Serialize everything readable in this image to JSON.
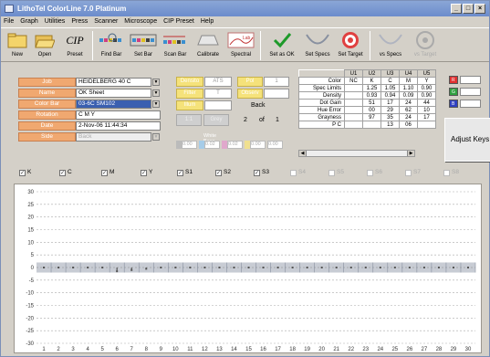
{
  "window": {
    "title": "LithoTel ColorLine 7.0 Platinum",
    "min_glyph": "_",
    "max_glyph": "□",
    "close_glyph": "×"
  },
  "menu": [
    "File",
    "Graph",
    "Utilities",
    "Press",
    "Scanner",
    "Microscope",
    "CIP Preset",
    "Help"
  ],
  "toolbar": [
    {
      "label": "New",
      "icon": "folder-icon"
    },
    {
      "label": "Open",
      "icon": "open-folder-icon"
    },
    {
      "label": "Preset",
      "icon": "cip-icon",
      "icon_text": "CIP"
    },
    {
      "label": "Find Bar",
      "icon": "find-bar-icon"
    },
    {
      "label": "Set Bar",
      "icon": "set-bar-icon"
    },
    {
      "label": "Scan Bar",
      "icon": "scan-bar-icon"
    },
    {
      "label": "Calibrate",
      "icon": "calibrate-icon"
    },
    {
      "label": "Spectral",
      "icon": "spectral-icon",
      "icon_text": "Lab"
    },
    {
      "label": "Set as OK",
      "icon": "checkmark-icon"
    },
    {
      "label": "Set Specs",
      "icon": "specs-icon"
    },
    {
      "label": "Set Target",
      "icon": "target-icon"
    },
    {
      "label": "vs Specs",
      "icon": "vs-specs-icon"
    },
    {
      "label": "vs Target",
      "icon": "vs-target-icon"
    }
  ],
  "job_panel": {
    "fields": [
      {
        "label": "Job",
        "value": "HEIDELBERG 40 C",
        "dropdown": true
      },
      {
        "label": "Name",
        "value": "OK Sheet",
        "dropdown": true
      },
      {
        "label": "Color Bar",
        "value": "03-6C SM102",
        "dropdown": true,
        "selected": true
      },
      {
        "label": "Rotation",
        "value": "C M Y",
        "dropdown": false
      },
      {
        "label": "Date",
        "value": "2-Nov-06 11:44:34",
        "dropdown": false
      },
      {
        "label": "Side",
        "value": "Back",
        "dropdown": true,
        "disabled": true
      }
    ]
  },
  "mid_panel": {
    "row1": [
      {
        "label": "Densito",
        "value": "ATS"
      },
      {
        "label": "Pol",
        "value": "1"
      }
    ],
    "row2": [
      {
        "label": "Filter",
        "value": "T"
      },
      {
        "label": "Observ",
        "value": ""
      }
    ],
    "row3": {
      "label": "Illum",
      "value": ""
    },
    "side": "Back",
    "page_current": "2",
    "page_of": "of",
    "page_total": "1",
    "row4": [
      "1:1",
      "Grey"
    ],
    "white_base_label": "White Base values",
    "white_base_values": [
      "0.00",
      "0.02",
      "0.02",
      "0.00",
      "0.00"
    ]
  },
  "spec_table": {
    "columns": [
      "",
      "U1",
      "U2",
      "U3",
      "U4",
      "U5"
    ],
    "rows": [
      {
        "label": "Color",
        "values": [
          "NC",
          "K",
          "C",
          "M",
          "Y"
        ]
      },
      {
        "label": "Spec Limits",
        "values": [
          "",
          "1.25",
          "1.05",
          "1.10",
          "0.90"
        ]
      },
      {
        "label": "Density",
        "values": [
          "",
          "0.93",
          "0.94",
          "0.09",
          "0.90"
        ]
      },
      {
        "label": "Dot Gain",
        "values": [
          "",
          "51",
          "17",
          "24",
          "44"
        ]
      },
      {
        "label": "Hue Error",
        "values": [
          "",
          "00",
          "29",
          "62",
          "10"
        ]
      },
      {
        "label": "Grayness",
        "values": [
          "",
          "97",
          "35",
          "24",
          "17"
        ]
      },
      {
        "label": "P C",
        "values": [
          "",
          "",
          "13",
          "06",
          ""
        ]
      }
    ]
  },
  "rgb_swatches": [
    {
      "name": "R",
      "color": "#e03030"
    },
    {
      "name": "G",
      "color": "#30a040"
    },
    {
      "name": "B",
      "color": "#3040c0"
    }
  ],
  "adjust_panel": {
    "label": "Adjust Keys"
  },
  "channel_checks": [
    {
      "label": "K",
      "checked": true,
      "enabled": true
    },
    {
      "label": "C",
      "checked": true,
      "enabled": true
    },
    {
      "label": "M",
      "checked": true,
      "enabled": true
    },
    {
      "label": "Y",
      "checked": true,
      "enabled": true
    },
    {
      "label": "S1",
      "checked": true,
      "enabled": true
    },
    {
      "label": "S2",
      "checked": true,
      "enabled": true
    },
    {
      "label": "S3",
      "checked": true,
      "enabled": true
    },
    {
      "label": "S4",
      "checked": false,
      "enabled": false
    },
    {
      "label": "S5",
      "checked": false,
      "enabled": false
    },
    {
      "label": "S6",
      "checked": false,
      "enabled": false
    },
    {
      "label": "S7",
      "checked": false,
      "enabled": false
    },
    {
      "label": "S8",
      "checked": false,
      "enabled": false
    }
  ],
  "chart_data": {
    "type": "line",
    "title": "",
    "xlabel": "",
    "ylabel": "",
    "x_ticks": [
      1,
      2,
      3,
      4,
      5,
      6,
      7,
      8,
      9,
      10,
      11,
      12,
      13,
      14,
      15,
      16,
      17,
      18,
      19,
      20,
      21,
      22,
      23,
      24,
      25,
      26,
      27,
      28,
      29,
      30
    ],
    "y_ticks": [
      30,
      25,
      20,
      15,
      10,
      5,
      0,
      -5,
      -10,
      -15,
      -20,
      -25,
      -30
    ],
    "xlim": [
      0.5,
      30.5
    ],
    "ylim": [
      -30,
      30
    ],
    "grid": true,
    "band": {
      "from": -2,
      "to": 2
    },
    "series": [
      {
        "color": "#555555",
        "values": [
          0,
          0,
          0,
          0,
          0,
          -1.5,
          -1,
          -0.5,
          0,
          0,
          0,
          0,
          0,
          0,
          0,
          0,
          0,
          0,
          0,
          0,
          0,
          0,
          0,
          0,
          0,
          0,
          0,
          0,
          0,
          0
        ]
      }
    ]
  }
}
